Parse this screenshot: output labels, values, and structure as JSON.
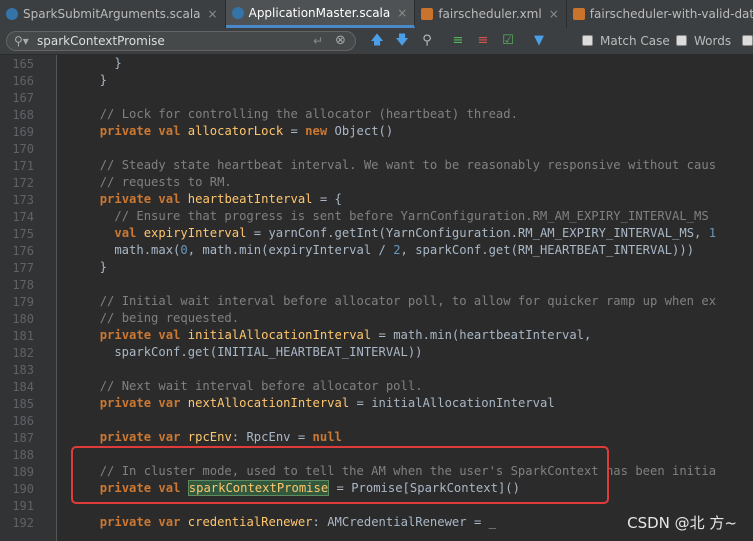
{
  "tabs": [
    {
      "label": "SparkSubmitArguments.scala",
      "type": "scala",
      "active": false
    },
    {
      "label": "ApplicationMaster.scala",
      "type": "scala",
      "active": true
    },
    {
      "label": "fairscheduler.xml",
      "type": "xml",
      "active": false
    },
    {
      "label": "fairscheduler-with-valid-data.xml",
      "type": "xml",
      "active": false
    }
  ],
  "search": {
    "query": "sparkContextPromise",
    "match_case_label": "Match Case",
    "words_label": "Words"
  },
  "colors": {
    "keyword": "#cc7832",
    "comment": "#808080",
    "number": "#6897bb",
    "highlight_bg": "#32593d",
    "annotation_box": "#e03b3b",
    "active_tab_accent": "#4a88c7"
  },
  "editor": {
    "lines": [
      {
        "num": "165",
        "code": "    }"
      },
      {
        "num": "166",
        "code": "  }"
      },
      {
        "num": "167",
        "code": ""
      },
      {
        "num": "168",
        "code": "  // Lock for controlling the allocator (heartbeat) thread."
      },
      {
        "num": "169",
        "code": "  private val allocatorLock = new Object()"
      },
      {
        "num": "170",
        "code": ""
      },
      {
        "num": "171",
        "code": "  // Steady state heartbeat interval. We want to be reasonably responsive without caus"
      },
      {
        "num": "172",
        "code": "  // requests to RM."
      },
      {
        "num": "173",
        "code": "  private val heartbeatInterval = {"
      },
      {
        "num": "174",
        "code": "    // Ensure that progress is sent before YarnConfiguration.RM_AM_EXPIRY_INTERVAL_MS"
      },
      {
        "num": "175",
        "code": "    val expiryInterval = yarnConf.getInt(YarnConfiguration.RM_AM_EXPIRY_INTERVAL_MS, 1"
      },
      {
        "num": "176",
        "code": "    math.max(0, math.min(expiryInterval / 2, sparkConf.get(RM_HEARTBEAT_INTERVAL)))"
      },
      {
        "num": "177",
        "code": "  }"
      },
      {
        "num": "178",
        "code": ""
      },
      {
        "num": "179",
        "code": "  // Initial wait interval before allocator poll, to allow for quicker ramp up when ex"
      },
      {
        "num": "180",
        "code": "  // being requested."
      },
      {
        "num": "181",
        "code": "  private val initialAllocationInterval = math.min(heartbeatInterval,"
      },
      {
        "num": "182",
        "code": "    sparkConf.get(INITIAL_HEARTBEAT_INTERVAL))"
      },
      {
        "num": "183",
        "code": ""
      },
      {
        "num": "184",
        "code": "  // Next wait interval before allocator poll."
      },
      {
        "num": "185",
        "code": "  private var nextAllocationInterval = initialAllocationInterval"
      },
      {
        "num": "186",
        "code": ""
      },
      {
        "num": "187",
        "code": "  private var rpcEnv: RpcEnv = null"
      },
      {
        "num": "188",
        "code": ""
      },
      {
        "num": "189",
        "code": "  // In cluster mode, used to tell the AM when the user's SparkContext has been initia"
      },
      {
        "num": "190",
        "code": "  private val sparkContextPromise = Promise[SparkContext]()"
      },
      {
        "num": "191",
        "code": ""
      },
      {
        "num": "192",
        "code": "  private var credentialRenewer: AMCredentialRenewer = _"
      }
    ]
  },
  "watermark": "CSDN @北 方~"
}
